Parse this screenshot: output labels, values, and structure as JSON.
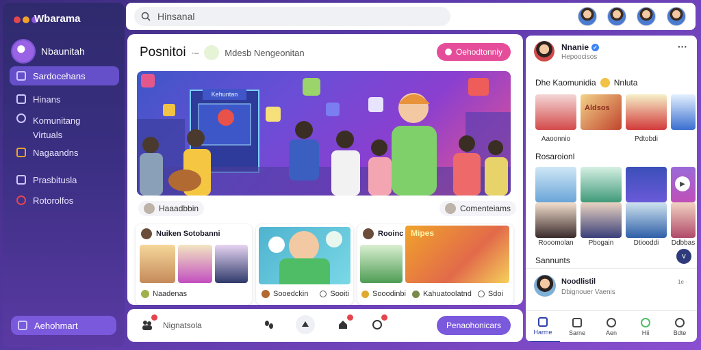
{
  "app": {
    "title": "Wbarama",
    "window_dots": [
      "#e4464e",
      "#f0a22b",
      "#8a57d9"
    ]
  },
  "sidebar": {
    "profile_name": "Nbaunitah",
    "items": [
      {
        "label": "Sardocehans",
        "active": true
      },
      {
        "label": "Hinans"
      },
      {
        "label": "Komunitang Virtuals"
      },
      {
        "label": "Nagaandns"
      },
      {
        "label": "Prasbitusla"
      },
      {
        "label": "Rotorolfos"
      }
    ],
    "bottom_button": "Aehohmart"
  },
  "search": {
    "placeholder": "Hinsanal"
  },
  "main": {
    "title": "Posnitoi",
    "sub": "Mdesb Nengeonitan",
    "action_button": "Oehodtonniy",
    "hero": {
      "sign_text": "Kehuntan"
    },
    "chips": {
      "left": "Haaadbbin",
      "right": "Comenteiams"
    },
    "cards": [
      {
        "title": "Nuiken Sotobanni",
        "footer": "Naadenas"
      },
      {
        "title": "",
        "footer_left": "Sooedckin",
        "footer_right": "Sooiti"
      },
      {
        "title": "Rooinc",
        "footer_left": "Sooodinbi",
        "footer_right": "Kahuatoolatnd",
        "footer_right2": "Sdoi",
        "poster_text": "Mipes"
      }
    ]
  },
  "bottombar": {
    "label": "Nignatsola",
    "button": "Penaohonicars"
  },
  "right": {
    "user_name": "Nnanie",
    "user_sub": "Hepoocisos",
    "section1": {
      "title": "Dhe Kaomunidia",
      "title_suffix": "Nnluta",
      "labels": [
        "Aaoonnio",
        "Pdtobdi"
      ],
      "poster_text": "Aldsos"
    },
    "section2": {
      "title": "Rosaroionl",
      "labels": [
        "Rooomolan",
        "Pbogain",
        "Dtiooddi",
        "Ddbbas"
      ]
    },
    "section3": {
      "title": "Sannunts"
    },
    "post": {
      "name": "Noodlistil",
      "sub": "Dbignouer Vaenis",
      "meta": "1e ·"
    },
    "tabs": [
      {
        "label": "Harme",
        "active": true
      },
      {
        "label": "Sarne"
      },
      {
        "label": "Aen"
      },
      {
        "label": "Hii"
      },
      {
        "label": "Bdte"
      }
    ]
  }
}
